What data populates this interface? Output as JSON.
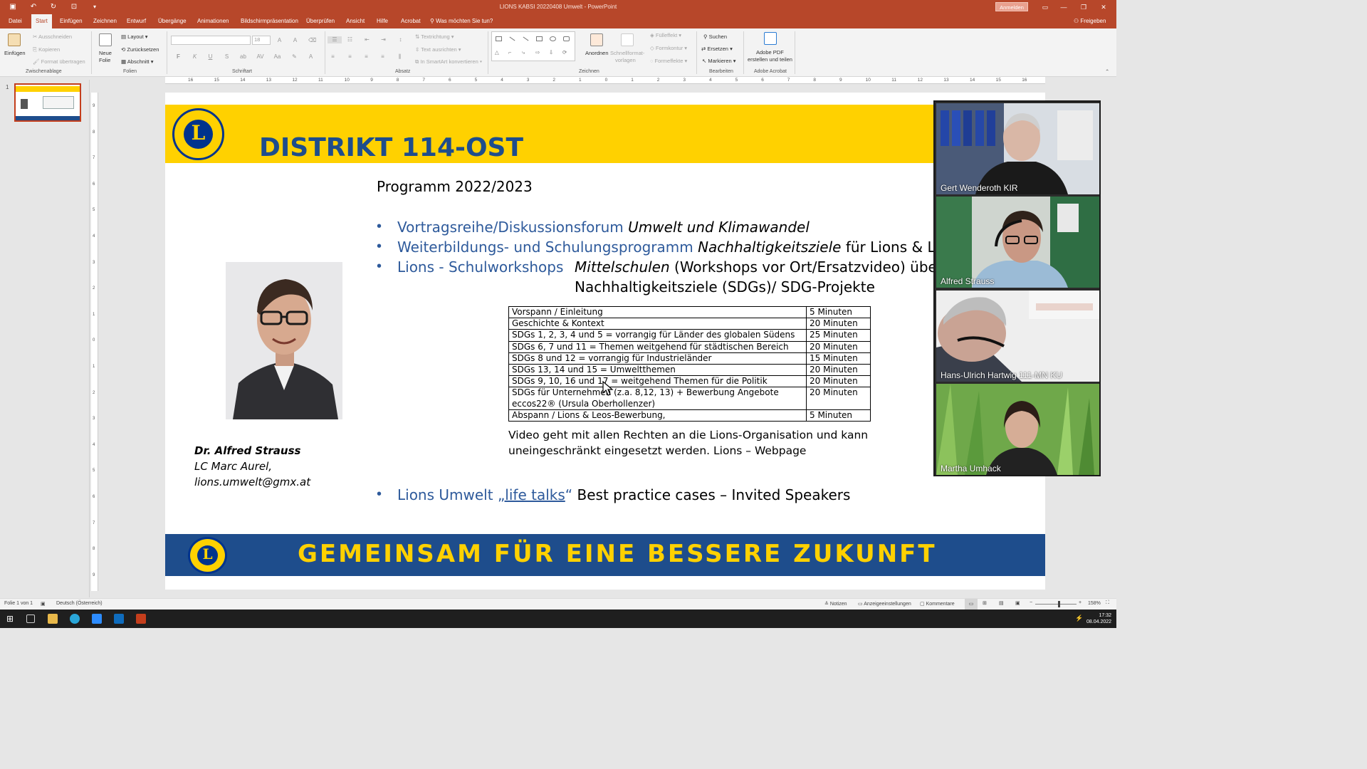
{
  "app": {
    "document_title": "LIONS KABSI 20220408 Umwelt  -  PowerPoint",
    "signin_label": "Anmelden"
  },
  "tabs": [
    "Datei",
    "Start",
    "Einfügen",
    "Zeichnen",
    "Entwurf",
    "Übergänge",
    "Animationen",
    "Bildschirmpräsentation",
    "Überprüfen",
    "Ansicht",
    "Hilfe",
    "Acrobat"
  ],
  "active_tab": "Start",
  "tell_me": "Was möchten Sie tun?",
  "share_label": "Freigeben",
  "ribbon": {
    "clipboard": {
      "paste": "Einfügen",
      "cut": "Ausschneiden",
      "copy": "Kopieren",
      "format_painter": "Format übertragen",
      "group": "Zwischenablage"
    },
    "slides": {
      "new_slide_1": "Neue",
      "new_slide_2": "Folie",
      "layout": "Layout",
      "reset": "Zurücksetzen",
      "section": "Abschnitt",
      "group": "Folien"
    },
    "font": {
      "size": "18",
      "group": "Schriftart",
      "bold": "F",
      "italic": "K",
      "underline": "U",
      "shadow": "S"
    },
    "paragraph": {
      "text_direction": "Textrichtung",
      "align_text": "Text ausrichten",
      "smartart": "In SmartArt konvertieren",
      "group": "Absatz"
    },
    "drawing": {
      "arrange": "Anordnen",
      "quick_styles_1": "Schnellformat-",
      "quick_styles_2": "vorlagen",
      "fill": "Fülleffekt",
      "outline": "Formkontur",
      "effects": "Formeffekte",
      "group": "Zeichnen"
    },
    "editing": {
      "find": "Suchen",
      "replace": "Ersetzen",
      "select": "Markieren",
      "group": "Bearbeiten"
    },
    "acrobat": {
      "create_1": "Adobe PDF",
      "create_2": "erstellen und teilen",
      "group": "Adobe Acrobat"
    }
  },
  "ruler_h": [
    "16",
    "15",
    "14",
    "13",
    "12",
    "11",
    "10",
    "9",
    "8",
    "7",
    "6",
    "5",
    "4",
    "3",
    "2",
    "1",
    "0",
    "1",
    "2",
    "3",
    "4",
    "5",
    "6",
    "7",
    "8",
    "9",
    "10",
    "11",
    "12",
    "13",
    "14",
    "15",
    "16"
  ],
  "ruler_v": [
    "9",
    "8",
    "7",
    "6",
    "5",
    "4",
    "3",
    "2",
    "1",
    "0",
    "1",
    "2",
    "3",
    "4",
    "5",
    "6",
    "7",
    "8",
    "9"
  ],
  "thumbnail": {
    "number": "1"
  },
  "slide": {
    "title": "DISTRIKT 114-OST",
    "logo_letter": "L",
    "program_title": "Programm 2022/2023",
    "bullet1": {
      "blue": "Vortragsreihe/Diskussionsforum ",
      "italic": "Umwelt und Klimawandel"
    },
    "bullet2": {
      "blue": "Weiterbildungs- und Schulungsprogramm ",
      "italic": "Nachhaltigkeitsziele",
      "plain": " für Lions & Leos."
    },
    "bullet3": {
      "blue": "Lions - Schulworkshops",
      "italic": "Mittelschulen",
      "plain": " (Workshops vor Ort/Ersatzvideo) über",
      "line2": "Nachhaltigkeitsziele (SDGs)/ SDG-Projekte"
    },
    "table": [
      {
        "topic": "Vorspann / Einleitung",
        "duration": "5 Minuten"
      },
      {
        "topic": "Geschichte & Kontext",
        "duration": "20 Minuten"
      },
      {
        "topic": "SDGs 1, 2, 3, 4 und 5 = vorrangig für Länder des globalen Südens",
        "duration": "25 Minuten"
      },
      {
        "topic": "SDGs 6, 7 und 11 = Themen weitgehend für städtischen Bereich",
        "duration": "20 Minuten"
      },
      {
        "topic": "SDGs 8 und 12 = vorrangig für Industrieländer",
        "duration": "15 Minuten"
      },
      {
        "topic": "SDGs 13, 14 und 15 = Umweltthemen",
        "duration": "20 Minuten"
      },
      {
        "topic": "SDGs 9, 10, 16 und 17 = weitgehend Themen für die Politik",
        "duration": "20 Minuten"
      },
      {
        "topic": "SDGs für Unternehmen (z.a. 8,12, 13) + Bewerbung Angebote eccos22® (Ursula Oberhollenzer)",
        "duration": "20 Minuten"
      },
      {
        "topic": "Abspann / Lions & Leos-Bewerbung,",
        "duration": "5 Minuten"
      }
    ],
    "video_note": "Video geht mit allen Rechten an die Lions-Organisation und kann uneingeschränkt eingesetzt werden. Lions – Webpage",
    "bullet4": {
      "blue": "Lions Umwelt ",
      "link": "„life talks",
      "quote": "“",
      "plain": " Best practice cases – Invited Speakers"
    },
    "speaker": {
      "name": "Dr. Alfred Strauss",
      "club": "LC Marc Aurel,",
      "email": "lions.umwelt@gmx.at"
    },
    "slogan": "GEMEINSAM FÜR EINE BESSERE ZUKUNFT"
  },
  "participants": [
    "Gert Wenderoth KIR",
    "Alfred Strauss",
    "Hans-Ulrich Hartwig 111-MN KU",
    "Martha Umhack"
  ],
  "statusbar": {
    "slide_info": "Folie 1 von 1",
    "language": "Deutsch (Österreich)",
    "notes": "Notizen",
    "display_settings": "Anzeigeeinstellungen",
    "comments": "Kommentare",
    "zoom": "158%"
  },
  "taskbar": {
    "time": "17:32",
    "date": "08.04.2022"
  },
  "colors": {
    "accent": "#b7472a",
    "lions_blue": "#1e4d8c",
    "lions_gold": "#ffd100"
  }
}
